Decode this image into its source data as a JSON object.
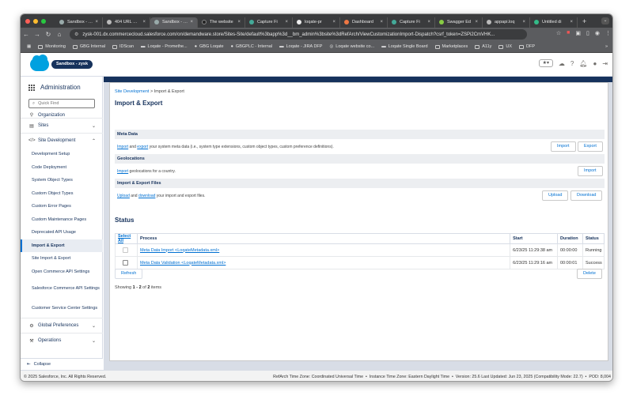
{
  "browser": {
    "tabs": [
      {
        "title": "Sandbox - zysk",
        "active": false
      },
      {
        "title": "404 URL Not Found",
        "active": false
      },
      {
        "title": "Sandbox - zysk",
        "active": true
      },
      {
        "title": "The website",
        "active": false
      },
      {
        "title": "Capture Fi",
        "active": false
      },
      {
        "title": "loqate-pr",
        "active": false
      },
      {
        "title": "Dashboard",
        "active": false
      },
      {
        "title": "Capture Fi",
        "active": false
      },
      {
        "title": "Swagger Ed",
        "active": false
      },
      {
        "title": "appapi.loq",
        "active": false
      },
      {
        "title": "Untitled di",
        "active": false
      }
    ],
    "url": "zysk-001.dx.commercecloud.salesforce.com/on/demandware.store/Sites-Site/default%3bapp%3d__bm_admin%3bsite%3dRefArch/ViewCustomizationImport-Dispatch?csrf_token=ZSPi2CmVHK...",
    "bookmarks": [
      "Monitoring",
      "GBG Internal",
      "IDScan",
      "Loqate - Promethe...",
      "GBG Loqate",
      "GBGPLC - Internal",
      "Loqate - JIRA DFP",
      "Loqate website co...",
      "Loqate Single Board",
      "Marketplaces",
      "A11y",
      "UX",
      "DFP"
    ]
  },
  "header": {
    "sandbox_label": "Sandbox - zysk"
  },
  "sidebar": {
    "title": "Administration",
    "quickfind_placeholder": "Quick Find",
    "organization": "Organization",
    "sites": "Sites",
    "site_development": "Site Development",
    "items": [
      "Development Setup",
      "Code Deployment",
      "System Object Types",
      "Custom Object Types",
      "Custom Error Pages",
      "Custom Maintenance Pages",
      "Deprecated API Usage",
      "Import & Export",
      "Site Import & Export",
      "Open Commerce API Settings",
      "Salesforce Commerce API Settings",
      "Customer Service Center Settings"
    ],
    "global_preferences": "Global Preferences",
    "operations": "Operations",
    "collapse": "Collapse"
  },
  "main": {
    "breadcrumb_link": "Site Development",
    "breadcrumb_sep": " > ",
    "breadcrumb_current": "Import & Export",
    "title": "Import & Export",
    "meta": {
      "heading": "Meta Data",
      "link1": "Import",
      "and": " and ",
      "link2": "export",
      "rest": " your system meta data (i.e., system type extensions, custom object types, custom preference definitions).",
      "import_btn": "Import",
      "export_btn": "Export"
    },
    "geo": {
      "heading": "Geolocations",
      "link": "Import",
      "rest": " geolocations for a country.",
      "import_btn": "Import"
    },
    "files": {
      "heading": "Import & Export Files",
      "link1": "Upload",
      "and": " and ",
      "link2": "download",
      "rest": " your import and export files.",
      "upload_btn": "Upload",
      "download_btn": "Download"
    },
    "status": {
      "title": "Status",
      "select_all": "Select All",
      "columns": [
        "Process",
        "Start",
        "Duration",
        "Status"
      ],
      "rows": [
        {
          "process": "Meta Data Import <LoqateMetadata.xml>",
          "start": "6/23/25 11:29:38 am",
          "duration": "00:00:00",
          "status": "Running"
        },
        {
          "process": "Meta Data Validation <LoqateMetadata.xml>",
          "start": "6/23/25 11:29:16 am",
          "duration": "00:00:01",
          "status": "Success"
        }
      ],
      "refresh": "Refresh",
      "delete": "Delete",
      "showing_prefix": "Showing ",
      "showing_range": "1 - 2",
      "showing_of": " of ",
      "showing_total": "2",
      "showing_suffix": " items"
    }
  },
  "footer": {
    "copyright": "© 2025 Salesforce, Inc. All Rights Reserved.",
    "info": "RefArch Time Zone: Coordinated Universal Time  •  Instance Time Zone: Eastern Daylight Time  •  Version: 25.6 Last Updated: Jun 23, 2025 (Compatibility Mode: 22.7)  •  POD: 8,004"
  },
  "colors": {
    "brand_blue": "#00a1e0",
    "nav_band": "#16325c",
    "link": "#0070d2"
  }
}
